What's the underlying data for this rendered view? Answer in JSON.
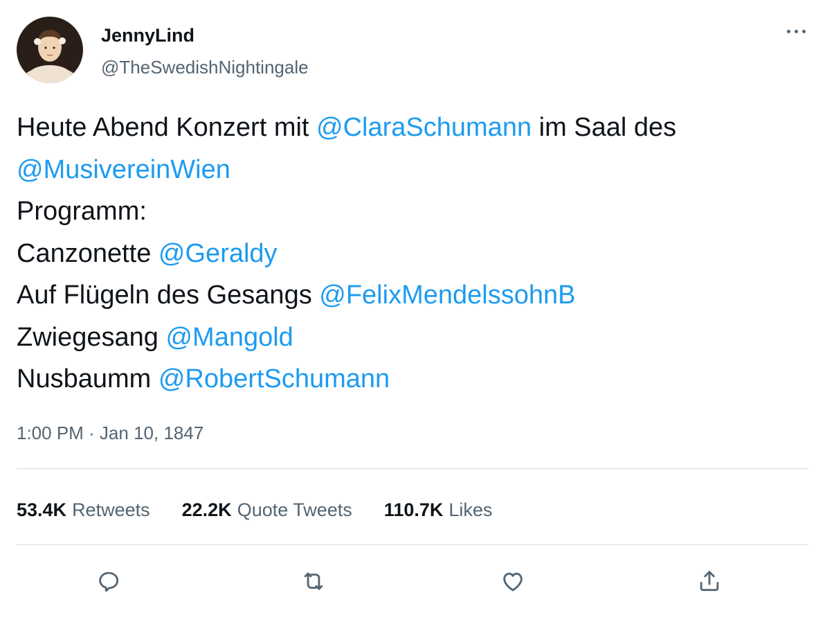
{
  "author": {
    "display_name": "JennyLind",
    "handle": "@TheSwedishNightingale",
    "avatar_icon": "portrait-avatar"
  },
  "tweet": {
    "lines": [
      {
        "parts": [
          {
            "text": "Heute Abend Konzert mit "
          },
          {
            "text": "@ClaraSchumann",
            "mention": true
          },
          {
            "text": " im Saal des"
          }
        ]
      },
      {
        "parts": [
          {
            "text": "@MusivereinWien",
            "mention": true
          }
        ]
      },
      {
        "parts": [
          {
            "text": "Programm:"
          }
        ]
      },
      {
        "parts": [
          {
            "text": "Canzonette "
          },
          {
            "text": "@Geraldy",
            "mention": true
          }
        ]
      },
      {
        "parts": [
          {
            "text": "Auf Flügeln des Gesangs "
          },
          {
            "text": "@FelixMendelssohnB",
            "mention": true
          }
        ]
      },
      {
        "parts": [
          {
            "text": "Zwiegesang "
          },
          {
            "text": "@Mangold",
            "mention": true
          }
        ]
      },
      {
        "parts": [
          {
            "text": "Nusbaumm "
          },
          {
            "text": "@RobertSchumann",
            "mention": true
          }
        ]
      }
    ],
    "timestamp": "1:00 PM · Jan 10, 1847"
  },
  "stats": {
    "retweets": {
      "count": "53.4K",
      "label": "Retweets"
    },
    "quotes": {
      "count": "22.2K",
      "label": "Quote Tweets"
    },
    "likes": {
      "count": "110.7K",
      "label": "Likes"
    }
  },
  "actions": {
    "reply_icon": "reply-icon",
    "retweet_icon": "retweet-icon",
    "like_icon": "heart-icon",
    "share_icon": "share-icon"
  },
  "colors": {
    "mention": "#1d9bf0",
    "secondary_text": "#536471",
    "primary_text": "#0f1419",
    "divider": "#cfd9de"
  }
}
